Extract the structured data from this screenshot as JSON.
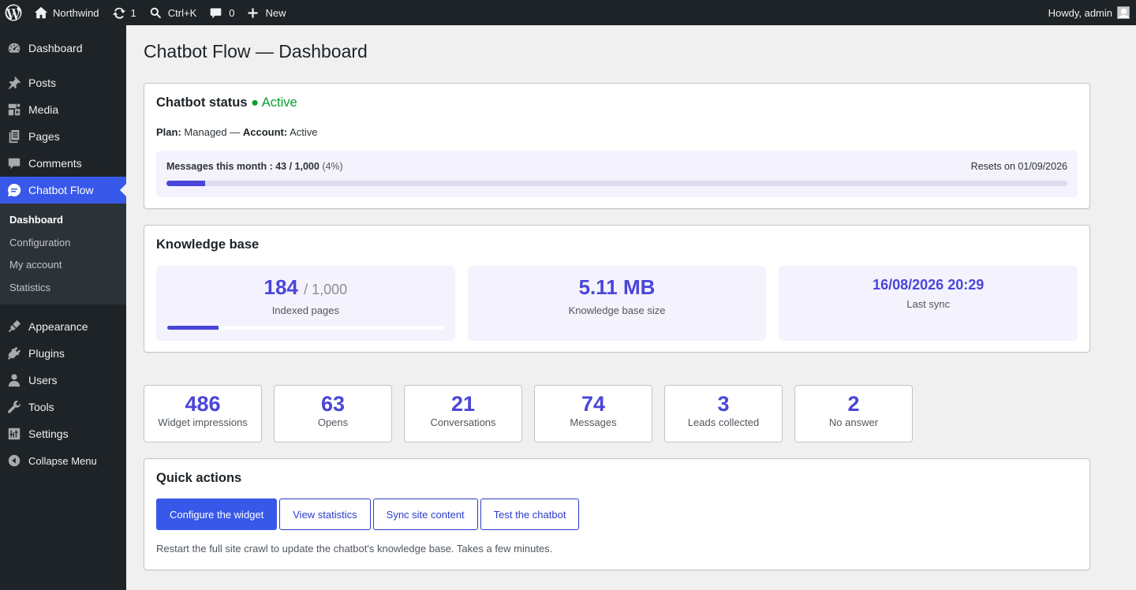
{
  "admin_bar": {
    "site_name": "Northwind",
    "updates_count": "1",
    "search_shortcut": "Ctrl+K",
    "comments_count": "0",
    "new_label": "New",
    "greeting": "Howdy, admin"
  },
  "sidebar": {
    "items": [
      {
        "label": "Dashboard",
        "icon": "dashboard-icon"
      },
      {
        "label": "Posts",
        "icon": "pin-icon"
      },
      {
        "label": "Media",
        "icon": "media-icon"
      },
      {
        "label": "Pages",
        "icon": "pages-icon"
      },
      {
        "label": "Comments",
        "icon": "comment-icon"
      },
      {
        "label": "Chatbot Flow",
        "icon": "chat-icon"
      },
      {
        "label": "Appearance",
        "icon": "brush-icon"
      },
      {
        "label": "Plugins",
        "icon": "plugin-icon"
      },
      {
        "label": "Users",
        "icon": "user-icon"
      },
      {
        "label": "Tools",
        "icon": "wrench-icon"
      },
      {
        "label": "Settings",
        "icon": "settings-icon"
      },
      {
        "label": "Collapse Menu",
        "icon": "collapse-icon"
      }
    ],
    "submenu": [
      "Dashboard",
      "Configuration",
      "My account",
      "Statistics"
    ]
  },
  "page": {
    "title": "Chatbot Flow — Dashboard"
  },
  "status": {
    "heading": "Chatbot status",
    "state": "● Active",
    "plan_label": "Plan:",
    "plan_value": "Managed —",
    "account_label": "Account:",
    "account_value": "Active",
    "usage_label": "Messages this month : 43 / 1,000",
    "usage_pct": "(4%)",
    "usage_fraction": 0.043,
    "reset_text": "Resets on 01/09/2026"
  },
  "knowledge_base": {
    "heading": "Knowledge base",
    "indexed_value": "184",
    "indexed_of": "/ 1,000",
    "indexed_label": "Indexed pages",
    "indexed_fraction": 0.184,
    "size_value": "5.11 MB",
    "size_label": "Knowledge base size",
    "sync_value": "16/08/2026 20:29",
    "sync_label": "Last sync"
  },
  "stats": [
    {
      "value": "486",
      "label": "Widget impressions"
    },
    {
      "value": "63",
      "label": "Opens"
    },
    {
      "value": "21",
      "label": "Conversations"
    },
    {
      "value": "74",
      "label": "Messages"
    },
    {
      "value": "3",
      "label": "Leads collected"
    },
    {
      "value": "2",
      "label": "No answer"
    }
  ],
  "quick_actions": {
    "heading": "Quick actions",
    "buttons": [
      "Configure the widget",
      "View statistics",
      "Sync site content",
      "Test the chatbot"
    ],
    "note": "Restart the full site crawl to update the chatbot's knowledge base. Takes a few minutes."
  },
  "colors": {
    "accent": "#3858e9",
    "stat_number": "#4a45d9",
    "status_active": "#00a32a",
    "sidebar_bg": "#1d2327"
  }
}
